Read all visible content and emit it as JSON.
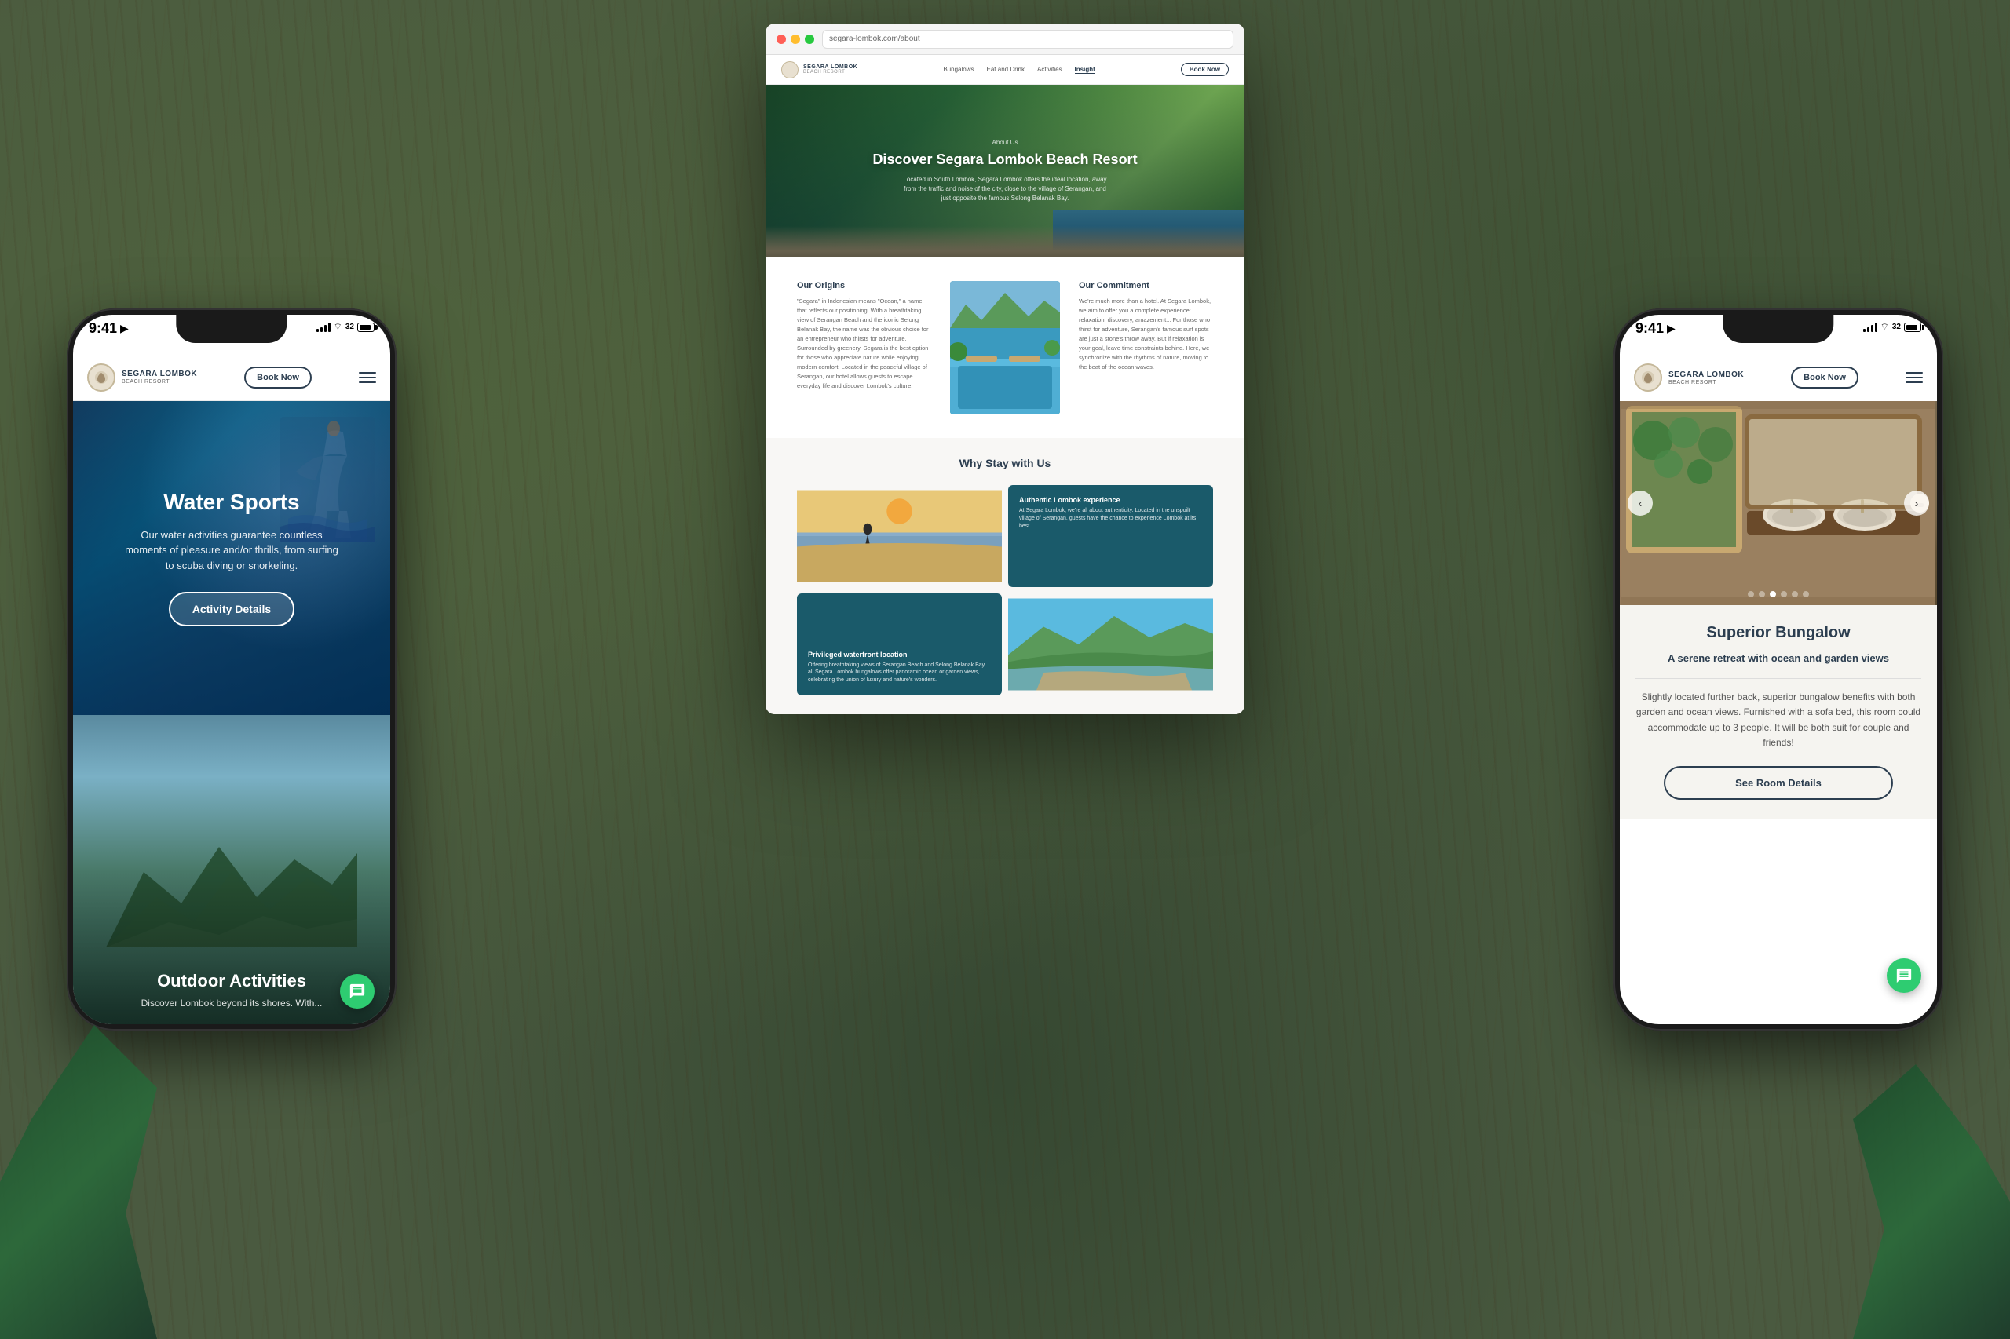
{
  "background": {
    "color": "#4a5a40"
  },
  "left_phone": {
    "status_bar": {
      "time": "9:41",
      "location_icon": "▶",
      "signal": "signal",
      "wifi": "wifi",
      "battery_badge": "32"
    },
    "navbar": {
      "brand_name": "SEGARA LOMBOK",
      "brand_sub": "BEACH RESORT",
      "book_btn": "Book Now",
      "menu_icon": "menu"
    },
    "water_sports": {
      "title": "Water Sports",
      "description": "Our water activities guarantee countless moments of pleasure and/or thrills, from surfing to scuba diving or snorkeling.",
      "btn_label": "Activity Details"
    },
    "outdoor": {
      "title": "Outdoor Activities",
      "description": "Discover Lombok beyond its shores. With..."
    }
  },
  "center_desktop": {
    "browser_url": "segara-lombok.com/about",
    "site_nav": {
      "brand_name": "SEGARA LOMBOK",
      "brand_sub": "BEACH RESORT",
      "links": [
        "Bungalows",
        "Eat and Drink",
        "Activities",
        "Insight"
      ],
      "active_link": "Insight",
      "book_btn": "Book Now"
    },
    "hero": {
      "about_label": "About Us",
      "title": "Discover Segara Lombok Beach Resort",
      "subtitle": "Located in South Lombok, Segara Lombok offers the ideal location, away from the traffic and noise of the city, close to the village of Serangan, and just opposite the famous Selong Belanak Bay."
    },
    "about_section": {
      "origins_title": "Our Origins",
      "origins_text": "\"Segara\" in Indonesian means \"Ocean,\" a name that reflects our positioning. With a breathtaking view of Serangan Beach and the iconic Selong Belanak Bay, the name was the obvious choice for an entrepreneur who thirsts for adventure. Surrounded by greenery, Segara is the best option for those who appreciate nature while enjoying modern comfort. Located in the peaceful village of Serangan, our hotel allows guests to escape everyday life and discover Lombok's culture.",
      "commitment_title": "Our Commitment",
      "commitment_text": "We're much more than a hotel. At Segara Lombok, we aim to offer you a complete experience: relaxation, discovery, amazement... For those who thirst for adventure, Serangan's famous surf spots are just a stone's throw away. But if relaxation is your goal, leave time constraints behind. Here, we synchronize with the rhythms of nature, moving to the beat of the ocean waves."
    },
    "why_section": {
      "title": "Why Stay with Us",
      "cards": [
        {
          "type": "beach",
          "title": "",
          "text": ""
        },
        {
          "type": "dark",
          "title": "Authentic Lombok experience",
          "text": "At Segara Lombok, we're all about authenticity. Located in the unspoilt village of Serangan, guests have the chance to experience Lombok at its best."
        },
        {
          "type": "dark2",
          "title": "Privileged waterfront location",
          "text": "Offering breathtaking views of Serangan Beach and Selong Belanak Bay, all Segara Lombok bungalows offer panoramic ocean or garden views, celebrating the union of luxury and nature's wonders."
        },
        {
          "type": "aerial",
          "title": "",
          "text": ""
        }
      ]
    }
  },
  "right_phone": {
    "status_bar": {
      "time": "9:41",
      "location_icon": "▶",
      "signal": "signal",
      "wifi": "wifi",
      "battery_badge": "32"
    },
    "navbar": {
      "brand_name": "SEGARA LOMBOK",
      "brand_sub": "BEACH RESORT",
      "book_btn": "Book Now",
      "menu_icon": "menu"
    },
    "carousel": {
      "dots_count": 6,
      "active_dot": 2,
      "nav_left": "‹",
      "nav_right": "›"
    },
    "room": {
      "title": "Superior Bungalow",
      "subtitle": "A serene retreat with ocean and garden views",
      "description": "Slightly located further back, superior bungalow benefits with both garden and ocean views. Furnished with a sofa bed, this room could accommodate up to 3 people. It will be both suit for couple and friends!",
      "btn_label": "See Room Details"
    }
  }
}
